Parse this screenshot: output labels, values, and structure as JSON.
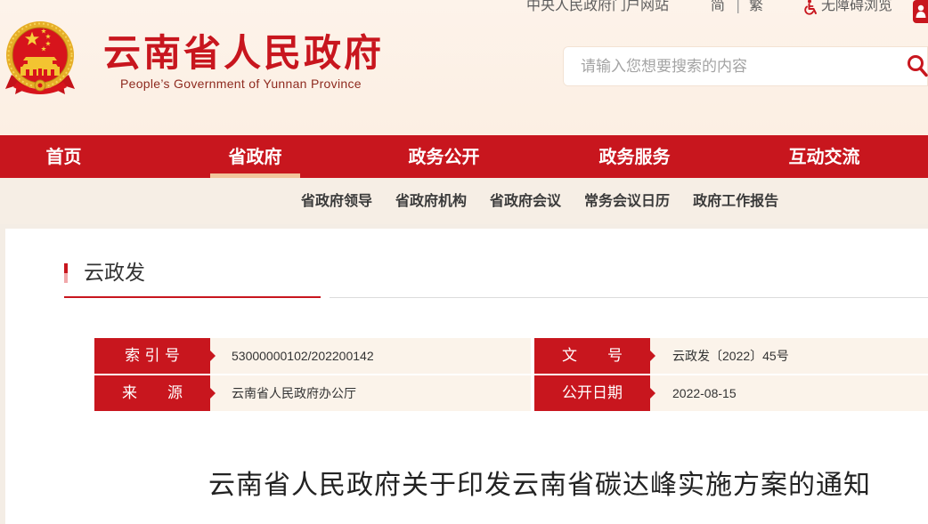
{
  "top_links": {
    "central_gov": "中央人民政府门户网站",
    "simplified": "简",
    "separator": "|",
    "traditional": "繁",
    "accessibility": "无障碍浏览",
    "accessibility_icon": "wheelchair-icon",
    "account_icon": "user-icon"
  },
  "brand": {
    "emblem": "national-emblem-icon",
    "title": "云南省人民政府",
    "subtitle": "People’s Government of Yunnan Province"
  },
  "search": {
    "placeholder": "请输入您想要搜索的内容",
    "icon": "search-icon"
  },
  "nav": {
    "active_index": 1,
    "items": [
      {
        "label": "首页"
      },
      {
        "label": "省政府"
      },
      {
        "label": "政务公开"
      },
      {
        "label": "政务服务"
      },
      {
        "label": "互动交流"
      }
    ]
  },
  "subnav": {
    "items": [
      {
        "label": "省政府领导"
      },
      {
        "label": "省政府机构"
      },
      {
        "label": "省政府会议"
      },
      {
        "label": "常务会议日历"
      },
      {
        "label": "政府工作报告"
      }
    ]
  },
  "section": {
    "title": "云政发"
  },
  "document_info": {
    "rows": [
      [
        {
          "label": "索 引 号",
          "value": "53000000102/202200142"
        },
        {
          "label": "文　　号",
          "value": "云政发〔2022〕45号"
        }
      ],
      [
        {
          "label": "来　　源",
          "value": "云南省人民政府办公厅"
        },
        {
          "label": "公开日期",
          "value": "2022-08-15"
        }
      ]
    ]
  },
  "article": {
    "title": "云南省人民政府关于印发云南省碳达峰实施方案的通知"
  },
  "colors": {
    "brand_red": "#c8161e",
    "header_bg": "#fcefe3",
    "subnav_bg": "#f6eee5",
    "nav_active_indicator": "#f2c49b",
    "info_value_bg": "#fbf3ea"
  }
}
